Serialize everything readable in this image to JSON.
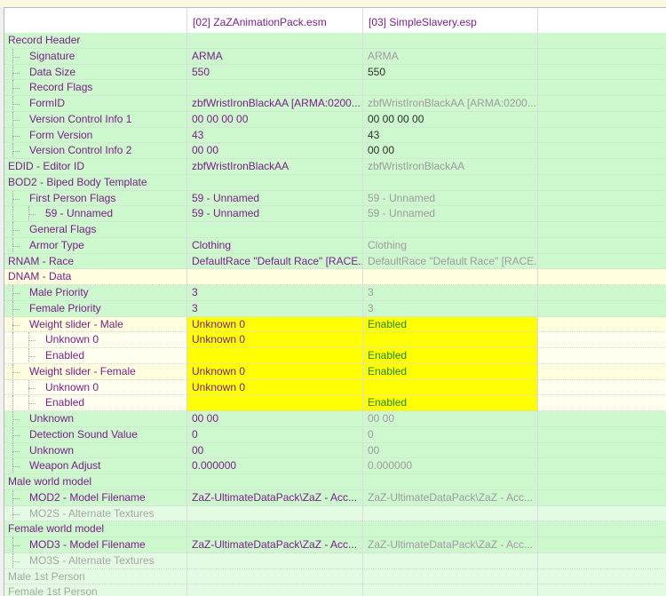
{
  "columns": [
    "",
    "[02] ZaZAnimationPack.esm",
    "[03] SimpleSlavery.esp"
  ],
  "rows": [
    {
      "label": "Record Header",
      "indent": 0,
      "v1": "",
      "v2": ""
    },
    {
      "label": "Signature",
      "indent": 1,
      "v1": "ARMA",
      "v2": "ARMA"
    },
    {
      "label": "Data Size",
      "indent": 1,
      "v1": "550",
      "v2": "550"
    },
    {
      "label": "Record Flags",
      "indent": 1,
      "v1": "",
      "v2": ""
    },
    {
      "label": "FormID",
      "indent": 1,
      "v1": "zbfWristIronBlackAA [ARMA:0200...",
      "v2": "zbfWristIronBlackAA [ARMA:0200..."
    },
    {
      "label": "Version Control Info 1",
      "indent": 1,
      "v1": "00 00 00 00",
      "v2": "00 00 00 00"
    },
    {
      "label": "Form Version",
      "indent": 1,
      "v1": "43",
      "v2": "43"
    },
    {
      "label": "Version Control Info 2",
      "indent": 1,
      "v1": "00 00",
      "v2": "00 00"
    },
    {
      "label": "EDID - Editor ID",
      "indent": 0,
      "v1": "zbfWristIronBlackAA",
      "v2": "zbfWristIronBlackAA"
    },
    {
      "label": "BOD2 - Biped Body Template",
      "indent": 0,
      "v1": "",
      "v2": ""
    },
    {
      "label": "First Person Flags",
      "indent": 1,
      "v1": "59 - Unnamed",
      "v2": "59 - Unnamed"
    },
    {
      "label": "59 - Unnamed",
      "indent": 2,
      "v1": "59 - Unnamed",
      "v2": "59 - Unnamed"
    },
    {
      "label": "General Flags",
      "indent": 1,
      "v1": "",
      "v2": ""
    },
    {
      "label": "Armor Type",
      "indent": 1,
      "v1": "Clothing",
      "v2": "Clothing"
    },
    {
      "label": "RNAM - Race",
      "indent": 0,
      "v1": "DefaultRace \"Default Race\" [RACE...",
      "v2": "DefaultRace \"Default Race\" [RACE..."
    },
    {
      "label": "DNAM - Data",
      "indent": 0,
      "v1": "",
      "v2": ""
    },
    {
      "label": "Male Priority",
      "indent": 1,
      "v1": "3",
      "v2": "3"
    },
    {
      "label": "Female Priority",
      "indent": 1,
      "v1": "3",
      "v2": "3"
    },
    {
      "label": "Weight slider - Male",
      "indent": 1,
      "v1": "Unknown 0",
      "v2": "Enabled"
    },
    {
      "label": "Unknown 0",
      "indent": 2,
      "v1": "Unknown 0",
      "v2": ""
    },
    {
      "label": "Enabled",
      "indent": 2,
      "v1": "",
      "v2": "Enabled"
    },
    {
      "label": "Weight slider - Female",
      "indent": 1,
      "v1": "Unknown 0",
      "v2": "Enabled"
    },
    {
      "label": "Unknown 0",
      "indent": 2,
      "v1": "Unknown 0",
      "v2": ""
    },
    {
      "label": "Enabled",
      "indent": 2,
      "v1": "",
      "v2": "Enabled"
    },
    {
      "label": "Unknown",
      "indent": 1,
      "v1": "00 00",
      "v2": "00 00"
    },
    {
      "label": "Detection Sound Value",
      "indent": 1,
      "v1": "0",
      "v2": "0"
    },
    {
      "label": "Unknown",
      "indent": 1,
      "v1": "00",
      "v2": "00"
    },
    {
      "label": "Weapon Adjust",
      "indent": 1,
      "v1": "0.000000",
      "v2": "0.000000"
    },
    {
      "label": "Male world model",
      "indent": 0,
      "v1": "",
      "v2": ""
    },
    {
      "label": "MOD2 - Model Filename",
      "indent": 1,
      "v1": "ZaZ-UltimateDataPack\\ZaZ - Acc...",
      "v2": "ZaZ-UltimateDataPack\\ZaZ - Acc..."
    },
    {
      "label": "MO2S - Alternate Textures",
      "indent": 1,
      "v1": "",
      "v2": ""
    },
    {
      "label": "Female world model",
      "indent": 0,
      "v1": "",
      "v2": ""
    },
    {
      "label": "MOD3 - Model Filename",
      "indent": 1,
      "v1": "ZaZ-UltimateDataPack\\ZaZ - Acc...",
      "v2": "ZaZ-UltimateDataPack\\ZaZ - Acc..."
    },
    {
      "label": "MO3S - Alternate Textures",
      "indent": 1,
      "v1": "",
      "v2": ""
    },
    {
      "label": "Male 1st Person",
      "indent": 0,
      "v1": "",
      "v2": ""
    },
    {
      "label": "Female 1st Person",
      "indent": 0,
      "v1": "",
      "v2": ""
    }
  ],
  "colors": {
    "label": "#7a1f8a",
    "row_match": "#cdf7cd",
    "row_light": "#e3fbe3",
    "row_diff": "#fefede",
    "highlight": "#ffff00",
    "value_enabled": "#1f8a1f"
  }
}
